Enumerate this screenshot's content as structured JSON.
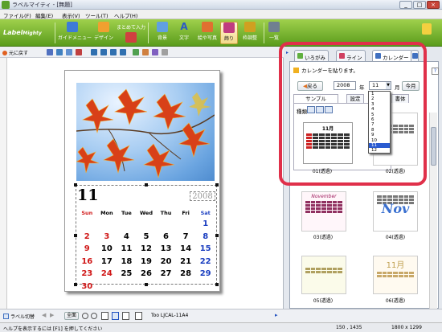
{
  "window": {
    "title": "ラベルマイティ - [無題]",
    "controls": [
      "_",
      "□",
      "×"
    ]
  },
  "menu": [
    "ファイル(F)",
    "編集(E)",
    "表示(V)",
    "ツール(T)",
    "ヘルプ(H)"
  ],
  "logo": {
    "main": "Label",
    "sub": "Mighty"
  },
  "toolbar": [
    {
      "label": "ガイドメニュー",
      "icon": "guide-menu-icon",
      "color": "#3d7bd8"
    },
    {
      "label": "デザイン",
      "icon": "design-icon",
      "color": "#f0a030"
    },
    {
      "label": "まとめて入力",
      "icon": "batch-input-icon",
      "color": "#d04040"
    },
    {
      "label": "背景",
      "icon": "background-icon",
      "color": "#60a0e0"
    },
    {
      "label": "文字",
      "icon": "text-icon",
      "color": "#2a58c8"
    },
    {
      "label": "絵や写真",
      "icon": "picture-icon",
      "color": "#e07030"
    },
    {
      "label": "飾り",
      "icon": "decoration-icon",
      "color": "#c03c80",
      "active": true
    },
    {
      "label": "枠調整",
      "icon": "frame-adjust-icon",
      "color": "#d0a020"
    },
    {
      "label": "一覧",
      "icon": "list-icon",
      "color": "#708090"
    }
  ],
  "subtoolbar": {
    "undo_label": "元に戻す"
  },
  "calendar": {
    "month": "11",
    "year": "2008",
    "weekdays": [
      "Sun",
      "Mon",
      "Tue",
      "Wed",
      "Thu",
      "Fri",
      "Sat"
    ],
    "weeks": [
      [
        "",
        "",
        "",
        "",
        "",
        "",
        "1"
      ],
      [
        "2",
        "3",
        "4",
        "5",
        "6",
        "7",
        "8"
      ],
      [
        "9",
        "10",
        "11",
        "12",
        "13",
        "14",
        "15"
      ],
      [
        "16",
        "17",
        "18",
        "19",
        "20",
        "21",
        "22"
      ],
      [
        "23",
        "24",
        "25",
        "26",
        "27",
        "28",
        "29"
      ],
      [
        "30",
        "",
        "",
        "",
        "",
        "",
        ""
      ]
    ]
  },
  "panel": {
    "tabs": [
      "いろがみ",
      "ライン",
      "カレンダー"
    ],
    "hint": "カレンダーを貼ります。",
    "back_label": "戻る",
    "year_value": "2008",
    "year_unit": "年",
    "month_value": "11",
    "month_unit": "月",
    "this_month_label": "今月",
    "subtabs": [
      "サンプル",
      "設定",
      "書体"
    ],
    "kind_label": "種類",
    "mini_title": "11月",
    "month_options": [
      "1",
      "2",
      "3",
      "4",
      "5",
      "6",
      "7",
      "8",
      "9",
      "10",
      "11",
      "12"
    ],
    "selected_month": "11",
    "thumbnails": [
      {
        "caption": "01(透過)",
        "title": "11月"
      },
      {
        "caption": "02(透過)",
        "title": ""
      },
      {
        "caption": "03(透過)",
        "title": "November"
      },
      {
        "caption": "04(透過)",
        "title": "Nov"
      },
      {
        "caption": "05(透過)",
        "title": ""
      },
      {
        "caption": "06(透過)",
        "title": "11月"
      }
    ]
  },
  "bottombar": {
    "layer_label": "ラベル切替",
    "zoom_label": "全面",
    "paper_label": "Too LJCAL-11A4"
  },
  "status": {
    "help": "ヘルプを表示するには [F1] を押してください",
    "coords": "150 , 1435",
    "size": "1800 x 1299"
  }
}
